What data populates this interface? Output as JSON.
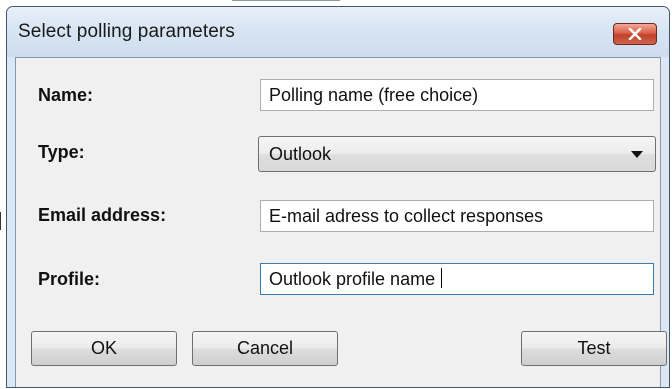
{
  "dialog": {
    "title": "Select polling parameters"
  },
  "fields": {
    "name": {
      "label": "Name:",
      "value": "Polling name (free choice)"
    },
    "type": {
      "label": "Type:",
      "selected": "Outlook"
    },
    "email": {
      "label": "Email address:",
      "value": "E-mail adress to collect responses"
    },
    "profile": {
      "label": "Profile:",
      "value": "Outlook profile name"
    }
  },
  "buttons": {
    "ok": "OK",
    "cancel": "Cancel",
    "test": "Test"
  },
  "icons": {
    "close": "close-icon",
    "dropdown": "chevron-down-icon"
  },
  "colors": {
    "close_button": "#c7452e",
    "frame": "#dbe7f4",
    "client_bg": "#f0f0f0"
  }
}
